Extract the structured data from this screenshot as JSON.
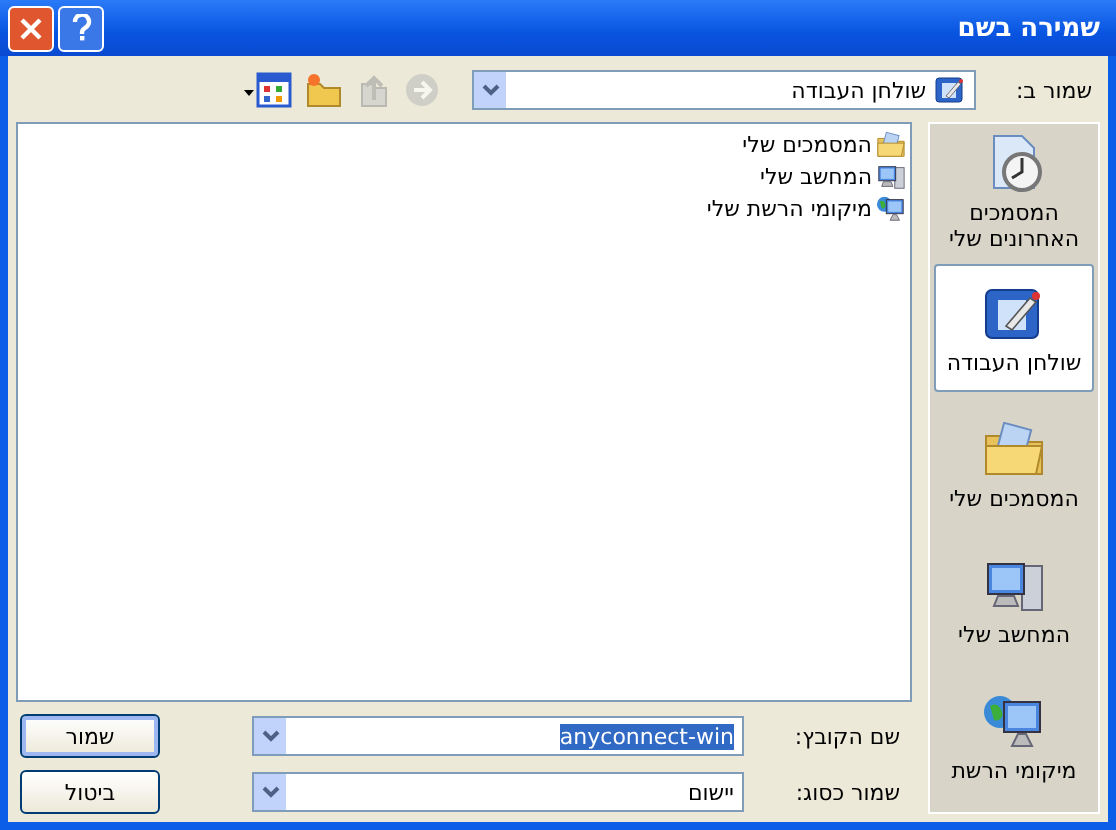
{
  "window": {
    "title": "שמירה בשם"
  },
  "save_in": {
    "label": "שמור ב:",
    "value": "שולחן העבודה"
  },
  "toolbar": [
    {
      "kind": "back",
      "disabled": true
    },
    {
      "kind": "up",
      "disabled": true
    },
    {
      "kind": "new-folder",
      "disabled": false
    },
    {
      "kind": "views",
      "disabled": false
    }
  ],
  "places": [
    {
      "label": "המסמכים האחרונים שלי",
      "kind": "recent",
      "selected": false
    },
    {
      "label": "שולחן העבודה",
      "kind": "desktop",
      "selected": true
    },
    {
      "label": "המסמכים שלי",
      "kind": "documents",
      "selected": false
    },
    {
      "label": "המחשב שלי",
      "kind": "computer",
      "selected": false
    },
    {
      "label": "מיקומי הרשת",
      "kind": "network",
      "selected": false
    }
  ],
  "files": [
    {
      "name": "המסמכים שלי",
      "kind": "documents"
    },
    {
      "name": "המחשב שלי",
      "kind": "computer"
    },
    {
      "name": "מיקומי הרשת שלי",
      "kind": "network"
    }
  ],
  "file_name": {
    "label": "שם הקובץ:",
    "value": "anyconnect-win"
  },
  "save_as_type": {
    "label": "שמור כסוג:",
    "value": "יישום"
  },
  "buttons": [
    {
      "label": "שמור",
      "kind": "save"
    },
    {
      "label": "ביטול",
      "kind": "cancel"
    }
  ]
}
